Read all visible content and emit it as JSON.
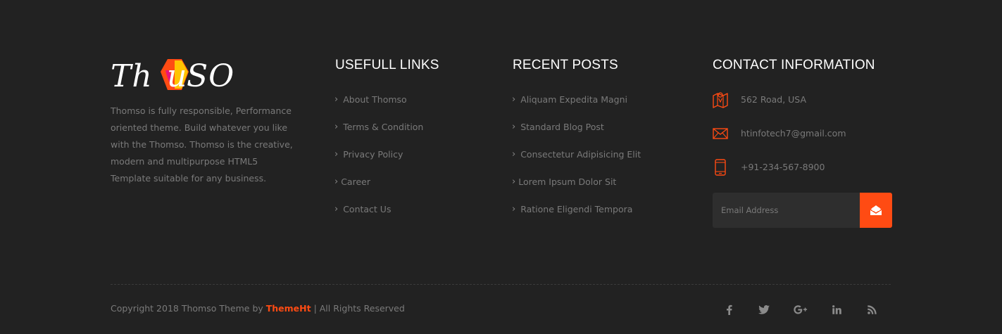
{
  "brand": {
    "logo_text": "Thomso",
    "about": "Thomso is fully responsible, Performance oriented theme. Build whatever you like with the Thomso. Thomso is the creative, modern and multipurpose HTML5 Template suitable for any business."
  },
  "useful_links": {
    "title": "USEFULL LINKS",
    "items": [
      {
        "label": "About Thomso"
      },
      {
        "label": "Terms & Condition"
      },
      {
        "label": "Privacy Policy"
      },
      {
        "label": "Career"
      },
      {
        "label": "Contact Us"
      }
    ]
  },
  "recent_posts": {
    "title": "RECENT POSTS",
    "items": [
      {
        "label": "Aliquam Expedita Magni"
      },
      {
        "label": "Standard Blog Post"
      },
      {
        "label": "Consectetur Adipisicing Elit"
      },
      {
        "label": "Lorem Ipsum Dolor Sit"
      },
      {
        "label": "Ratione Eligendi Tempora"
      }
    ]
  },
  "contact": {
    "title": "CONTACT INFORMATION",
    "address": "562 Road, USA",
    "email": "htinfotech7@gmail.com",
    "phone": "+91-234-567-8900",
    "subscribe_placeholder": "Email Address"
  },
  "footer_bottom": {
    "copyright_prefix": "Copyright 2018 Thomso Theme by ",
    "brand_link": "ThemeHt",
    "copyright_suffix": " | All Rights Reserved"
  },
  "social": [
    {
      "icon": "facebook-icon"
    },
    {
      "icon": "twitter-icon"
    },
    {
      "icon": "google-plus-icon"
    },
    {
      "icon": "linkedin-icon"
    },
    {
      "icon": "rss-icon"
    }
  ],
  "colors": {
    "background": "#222222",
    "accent": "#ff4b13",
    "text_muted": "#7a7a7a",
    "heading": "#ffffff"
  }
}
